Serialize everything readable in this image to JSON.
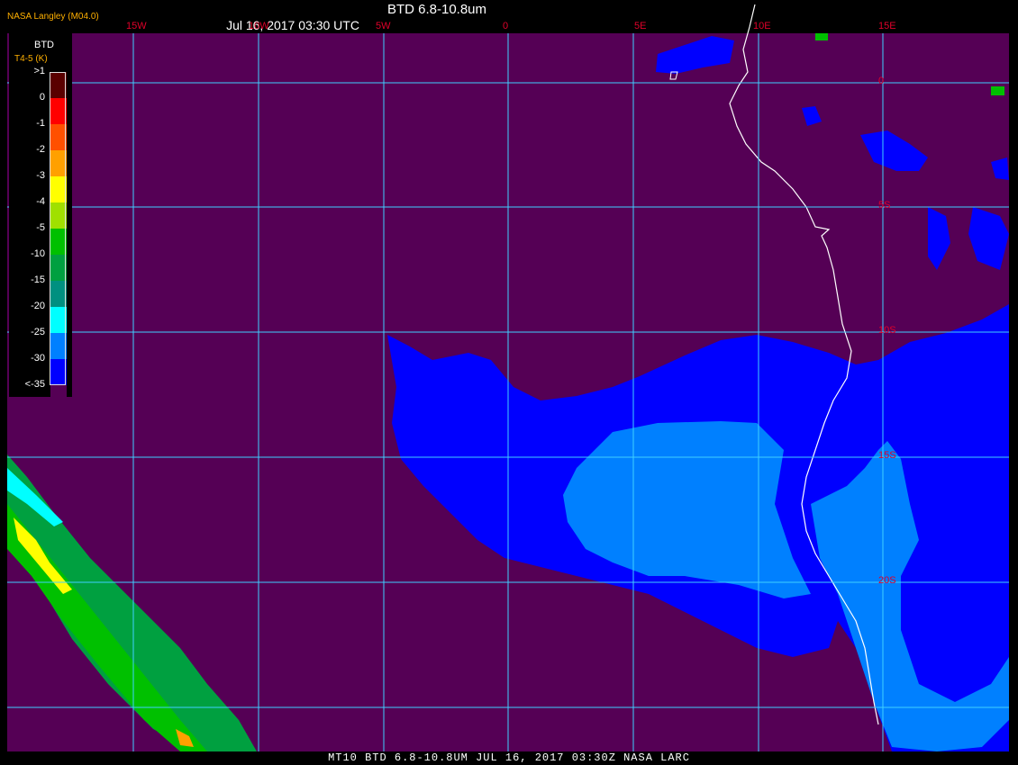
{
  "header": {
    "title": "BTD 6.8-10.8um",
    "datetime": "Jul 16, 2017 03:30 UTC",
    "brand": "NASA Langley (M04.0)"
  },
  "footer": {
    "text": "MT10   BTD 6.8-10.8UM   JUL 16, 2017 03:30Z   NASA LARC"
  },
  "legend": {
    "title": "BTD",
    "subtitle": "T4-5 (K)",
    "entries": [
      {
        "label": ">1",
        "color": "#5a0000"
      },
      {
        "label": "0",
        "color": "#ff0000"
      },
      {
        "label": "-1",
        "color": "#ff5000"
      },
      {
        "label": "-2",
        "color": "#ffa000"
      },
      {
        "label": "-3",
        "color": "#ffff00"
      },
      {
        "label": "-4",
        "color": "#a0e000"
      },
      {
        "label": "-5",
        "color": "#00c000"
      },
      {
        "label": "-10",
        "color": "#00a040"
      },
      {
        "label": "-15",
        "color": "#009080"
      },
      {
        "label": "-20",
        "color": "#00ffff"
      },
      {
        "label": "-25",
        "color": "#0080ff"
      },
      {
        "label": "-30",
        "color": "#0000ff"
      },
      {
        "label": "<-35",
        "color": "#550055"
      }
    ]
  },
  "map": {
    "background_color": "#550055",
    "grid_color": "#40d0ff",
    "coast_color": "#ffffff",
    "longitude_labels": [
      "15W",
      "10W",
      "5W",
      "0",
      "5E",
      "10E",
      "15E"
    ],
    "latitude_labels": [
      "0",
      "5S",
      "10S",
      "15S",
      "20S"
    ]
  }
}
